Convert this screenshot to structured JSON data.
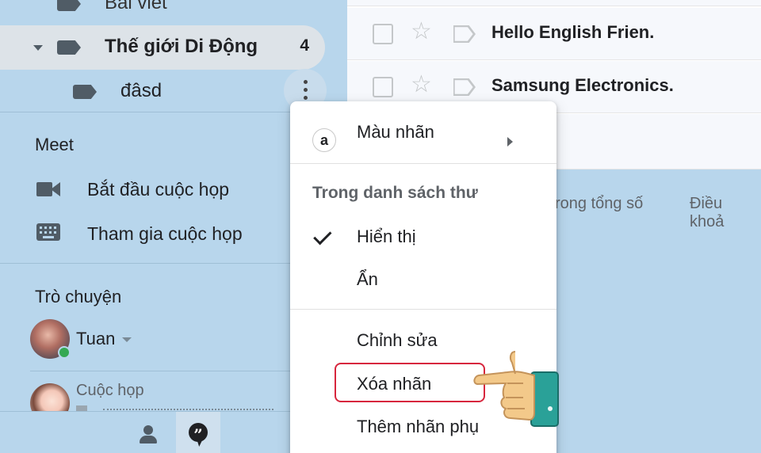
{
  "sidebar": {
    "labels": [
      {
        "name": "Bài viết"
      },
      {
        "name": "Thế giới Di Động",
        "count": "4"
      },
      {
        "name": "đâsd"
      }
    ],
    "meet": {
      "title": "Meet",
      "items": [
        {
          "label": "Bắt đầu cuộc họp",
          "icon": "video-camera-icon"
        },
        {
          "label": "Tham gia cuộc họp",
          "icon": "keyboard-icon"
        }
      ]
    },
    "chat": {
      "title": "Trò chuyện",
      "user": "Tuan",
      "conversation": "Cuộc họp"
    }
  },
  "mail_list": {
    "rows": [
      {
        "sender": "Hello English Frien."
      },
      {
        "sender": "Samsung Electronics."
      }
    ],
    "footer": [
      "rong tổng số",
      "Điều khoả"
    ]
  },
  "context_menu": {
    "color_item": {
      "badge": "a",
      "label": "Màu nhãn"
    },
    "section_header": "Trong danh sách thư",
    "show": "Hiển thị",
    "hide": "Ẩn",
    "edit": "Chỉnh sửa",
    "delete": "Xóa nhãn",
    "add_sublabel": "Thêm nhãn phụ"
  },
  "colors": {
    "sidebar_bg": "#b8d6ec",
    "selected_label_bg": "#dde3e8",
    "highlight_border": "#d7263d",
    "online": "#34a853"
  }
}
